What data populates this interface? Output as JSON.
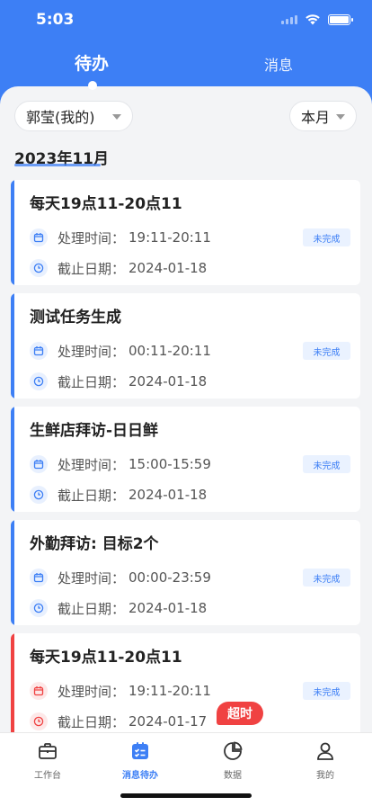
{
  "status_bar": {
    "time": "5:03"
  },
  "tabs": {
    "todo": "待办",
    "messages": "消息"
  },
  "filters": {
    "person": "郭莹(我的)",
    "period": "本月"
  },
  "month_title": "2023年11月",
  "colors": {
    "primary": "#3d7ff5",
    "overdue": "#f04242"
  },
  "labels": {
    "process_time": "处理时间：",
    "deadline": "截止日期："
  },
  "cards": [
    {
      "title": "每天19点11-20点11",
      "process_time": "19:11-20:11",
      "deadline": "2024-01-18",
      "status": "未完成",
      "overdue": false
    },
    {
      "title": "测试任务生成",
      "process_time": "00:11-20:11",
      "deadline": "2024-01-18",
      "status": "未完成",
      "overdue": false
    },
    {
      "title": "生鲜店拜访-日日鲜",
      "process_time": "15:00-15:59",
      "deadline": "2024-01-18",
      "status": "未完成",
      "overdue": false
    },
    {
      "title": "外勤拜访: 目标2个",
      "process_time": "00:00-23:59",
      "deadline": "2024-01-18",
      "status": "未完成",
      "overdue": false
    },
    {
      "title": "每天19点11-20点11",
      "process_time": "19:11-20:11",
      "deadline": "2024-01-17",
      "status": "未完成",
      "overdue": true,
      "overdue_label": "超时"
    }
  ],
  "bottom_nav": [
    {
      "label": "工作台",
      "icon": "briefcase-icon",
      "active": false
    },
    {
      "label": "消息待办",
      "icon": "task-list-icon",
      "active": true
    },
    {
      "label": "数据",
      "icon": "pie-chart-icon",
      "active": false
    },
    {
      "label": "我的",
      "icon": "person-icon",
      "active": false
    }
  ]
}
